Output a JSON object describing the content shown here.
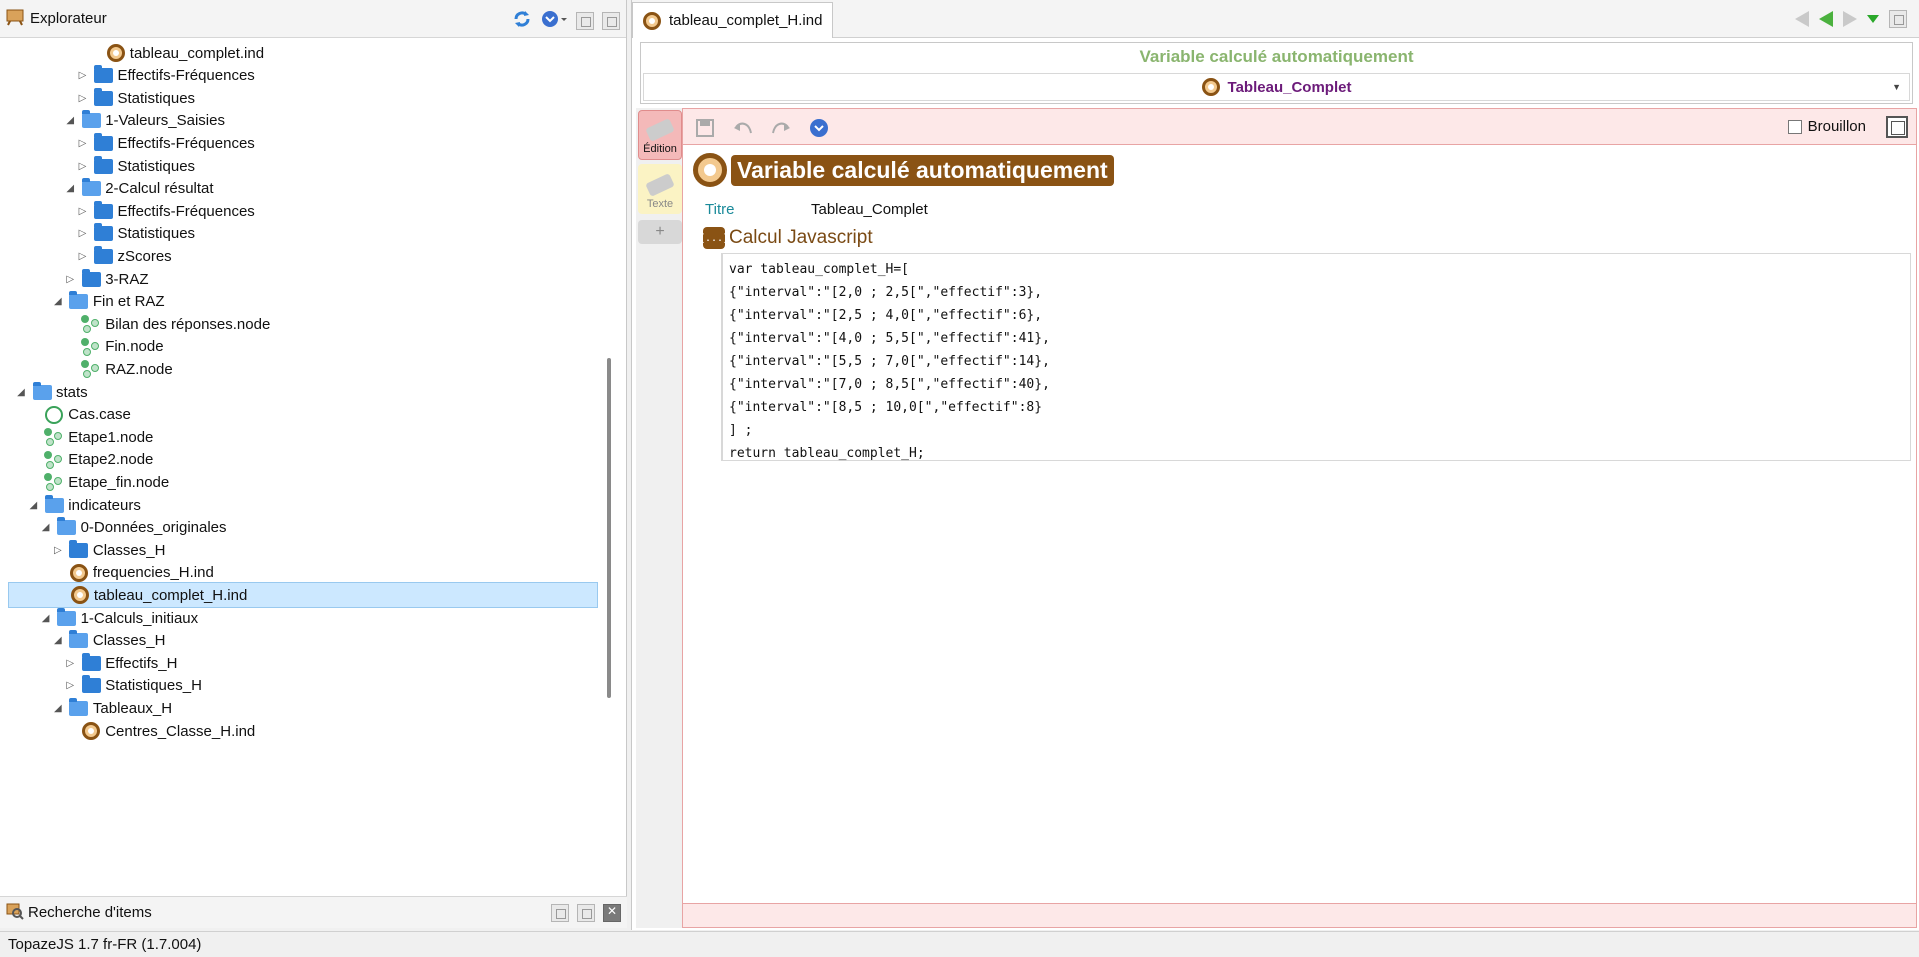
{
  "explorer": {
    "title": "Explorateur",
    "tree": [
      {
        "label": "tableau_complet.ind",
        "type": "ind",
        "depth": 6,
        "arrow": ""
      },
      {
        "label": "Effectifs-Fréquences",
        "type": "folder",
        "depth": 5,
        "arrow": "collapsed"
      },
      {
        "label": "Statistiques",
        "type": "folder",
        "depth": 5,
        "arrow": "collapsed"
      },
      {
        "label": "1-Valeurs_Saisies",
        "type": "folder-open",
        "depth": 4,
        "arrow": "expanded"
      },
      {
        "label": "Effectifs-Fréquences",
        "type": "folder",
        "depth": 5,
        "arrow": "collapsed"
      },
      {
        "label": "Statistiques",
        "type": "folder",
        "depth": 5,
        "arrow": "collapsed"
      },
      {
        "label": "2-Calcul résultat",
        "type": "folder-open",
        "depth": 4,
        "arrow": "expanded"
      },
      {
        "label": "Effectifs-Fréquences",
        "type": "folder",
        "depth": 5,
        "arrow": "collapsed"
      },
      {
        "label": "Statistiques",
        "type": "folder",
        "depth": 5,
        "arrow": "collapsed"
      },
      {
        "label": "zScores",
        "type": "folder",
        "depth": 5,
        "arrow": "collapsed"
      },
      {
        "label": "3-RAZ",
        "type": "folder",
        "depth": 4,
        "arrow": "collapsed"
      },
      {
        "label": "Fin et RAZ",
        "type": "folder-open",
        "depth": 3,
        "arrow": "expanded"
      },
      {
        "label": "Bilan des réponses.node",
        "type": "node",
        "depth": 4,
        "arrow": ""
      },
      {
        "label": "Fin.node",
        "type": "node",
        "depth": 4,
        "arrow": ""
      },
      {
        "label": "RAZ.node",
        "type": "node",
        "depth": 4,
        "arrow": ""
      },
      {
        "label": "stats",
        "type": "folder-open",
        "depth": 0,
        "arrow": "expanded"
      },
      {
        "label": "Cas.case",
        "type": "case",
        "depth": 1,
        "arrow": ""
      },
      {
        "label": "Etape1.node",
        "type": "node",
        "depth": 1,
        "arrow": ""
      },
      {
        "label": "Etape2.node",
        "type": "node",
        "depth": 1,
        "arrow": ""
      },
      {
        "label": "Etape_fin.node",
        "type": "node",
        "depth": 1,
        "arrow": ""
      },
      {
        "label": "indicateurs",
        "type": "folder-open",
        "depth": 1,
        "arrow": "expanded"
      },
      {
        "label": "0-Données_originales",
        "type": "folder-open",
        "depth": 2,
        "arrow": "expanded"
      },
      {
        "label": "Classes_H",
        "type": "folder",
        "depth": 3,
        "arrow": "collapsed"
      },
      {
        "label": "frequencies_H.ind",
        "type": "ind",
        "depth": 3,
        "arrow": ""
      },
      {
        "label": "tableau_complet_H.ind",
        "type": "ind",
        "depth": 3,
        "arrow": "",
        "selected": true
      },
      {
        "label": "1-Calculs_initiaux",
        "type": "folder-open",
        "depth": 2,
        "arrow": "expanded"
      },
      {
        "label": "Classes_H",
        "type": "folder-open",
        "depth": 3,
        "arrow": "expanded"
      },
      {
        "label": "Effectifs_H",
        "type": "folder",
        "depth": 4,
        "arrow": "collapsed"
      },
      {
        "label": "Statistiques_H",
        "type": "folder",
        "depth": 4,
        "arrow": "collapsed"
      },
      {
        "label": "Tableaux_H",
        "type": "folder-open",
        "depth": 3,
        "arrow": "expanded"
      },
      {
        "label": "Centres_Classe_H.ind",
        "type": "ind",
        "depth": 4,
        "arrow": ""
      }
    ]
  },
  "search_panel": {
    "title": "Recherche d'items"
  },
  "statusbar": {
    "text": "TopazeJS 1.7 fr-FR (1.7.004)"
  },
  "editor": {
    "tab_label": "tableau_complet_H.ind",
    "info_title": "Variable calculé automatiquement",
    "info_select": "Tableau_Complet",
    "sidetabs": {
      "edition": "Édition",
      "texte": "Texte",
      "add": "+"
    },
    "brouillon_label": "Brouillon",
    "big_title": "Variable calculé automatiquement",
    "titre_label": "Titre",
    "titre_value": "Tableau_Complet",
    "section_title": "Calcul Javascript",
    "js_icon_text": "{...}",
    "code_lines": [
      "var tableau_complet_H=[",
      "{\"interval\":\"[2,0 ; 2,5[\",\"effectif\":3},",
      "{\"interval\":\"[2,5 ; 4,0[\",\"effectif\":6},",
      "{\"interval\":\"[4,0 ; 5,5[\",\"effectif\":41},",
      "{\"interval\":\"[5,5 ; 7,0[\",\"effectif\":14},",
      "{\"interval\":\"[7,0 ; 8,5[\",\"effectif\":40},",
      "{\"interval\":\"[8,5 ; 10,0[\",\"effectif\":8}",
      "] ;",
      "return tableau_complet_H;"
    ]
  },
  "colors": {
    "folder": "#2f7fd6",
    "selection": "#cce8ff",
    "title_brown": "#8a5314",
    "info_green": "#8ab56f",
    "select_purple": "#6c1b7a",
    "label_teal": "#1a8a9a"
  }
}
